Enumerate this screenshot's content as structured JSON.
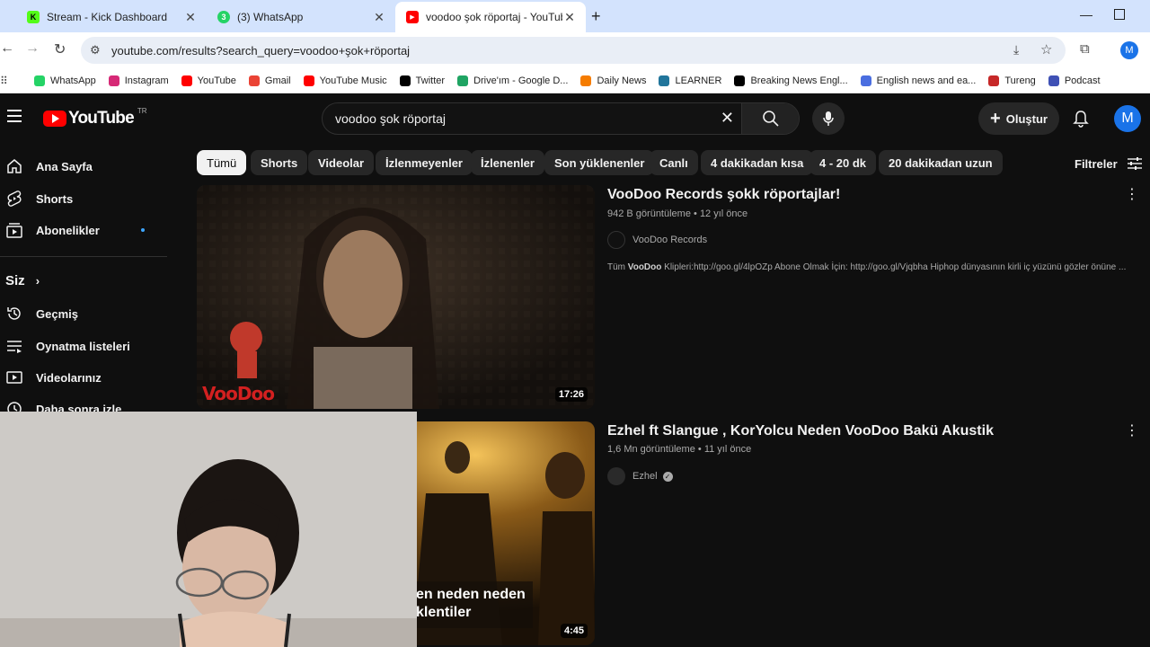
{
  "tabs": [
    {
      "label": "Stream - Kick Dashboard",
      "favicon": "K",
      "favicon_color": "#53fc18"
    },
    {
      "label": "(3) WhatsApp",
      "favicon": "3",
      "favicon_color": "#25d366"
    },
    {
      "label": "voodoo şok röportaj - YouTube",
      "favicon": "▶",
      "favicon_color": "#ff0000",
      "active": true
    }
  ],
  "new_tab_label": "+",
  "omnibox": {
    "url": "youtube.com/results?search_query=voodoo+şok+röportaj"
  },
  "profile_initial": "M",
  "bookmarks": [
    {
      "label": "WhatsApp",
      "icon": "whatsapp-icon",
      "color": "#25d366"
    },
    {
      "label": "Instagram",
      "icon": "instagram-icon",
      "color": "#d62976"
    },
    {
      "label": "YouTube",
      "icon": "youtube-icon",
      "color": "#ff0000"
    },
    {
      "label": "Gmail",
      "icon": "gmail-icon",
      "color": "#ea4335"
    },
    {
      "label": "YouTube Music",
      "icon": "youtube-music-icon",
      "color": "#ff0000"
    },
    {
      "label": "Twitter",
      "icon": "x-icon",
      "color": "#000000"
    },
    {
      "label": "Drive'ım - Google D...",
      "icon": "drive-icon",
      "color": "#1fa463"
    },
    {
      "label": "Daily News",
      "icon": "daily-news-icon",
      "color": "#f57c00"
    },
    {
      "label": "LEARNER",
      "icon": "wordpress-icon",
      "color": "#21759b"
    },
    {
      "label": "Breaking News Engl...",
      "icon": "b-icon",
      "color": "#000000"
    },
    {
      "label": "English news and ea...",
      "icon": "globe-icon",
      "color": "#4a6ee0"
    },
    {
      "label": "Tureng",
      "icon": "tureng-icon",
      "color": "#c62828"
    },
    {
      "label": "Podcast",
      "icon": "podcast-icon",
      "color": "#3f51b5"
    }
  ],
  "youtube": {
    "logo_text": "YouTube",
    "region": "TR",
    "search_query": "voodoo şok röportaj",
    "create_label": "Oluştur",
    "avatar_initial": "M",
    "accent": "#ff0000"
  },
  "sidebar": {
    "items": [
      {
        "label": "Ana Sayfa",
        "icon": "home-icon"
      },
      {
        "label": "Shorts",
        "icon": "shorts-icon"
      },
      {
        "label": "Abonelikler",
        "icon": "subscriptions-icon"
      }
    ],
    "you_section": "Siz",
    "you_items": [
      {
        "label": "Geçmiş",
        "icon": "history-icon"
      },
      {
        "label": "Oynatma listeleri",
        "icon": "playlists-icon"
      },
      {
        "label": "Videolarınız",
        "icon": "your-videos-icon"
      },
      {
        "label": "Daha sonra izle",
        "icon": "watch-later-icon"
      }
    ]
  },
  "chips": [
    "Tümü",
    "Shorts",
    "Videolar",
    "İzlenmeyenler",
    "İzlenenler",
    "Son yüklenenler",
    "Canlı",
    "4 dakikadan kısa",
    "4 - 20 dk",
    "20 dakikadan uzun"
  ],
  "filters_label": "Filtreler",
  "results": [
    {
      "title": "VooDoo Records şokk röportajlar!",
      "views": "942 B görüntüleme",
      "age": "12 yıl önce",
      "channel": "VooDoo Records",
      "duration": "17:26",
      "description_prefix": "Tüm ",
      "description_bold": "VooDoo",
      "description_rest": " Klipleri:http://goo.gl/4lpOZp Abone Olmak İçin: http://goo.gl/Vjqbha Hiphop dünyasının kirli iç yüzünü gözler önüne ...",
      "thumb_overlay": "VooDoo"
    },
    {
      "title": "Ezhel ft Slangue , KorYolcu Neden VooDoo Bakü Akustik",
      "views": "1,6 Mn görüntüleme",
      "age": "11 yıl önce",
      "channel": "Ezhel",
      "duration": "4:45",
      "thumb_caption_1": "en neden neden",
      "thumb_caption_2": "klentiler"
    }
  ]
}
